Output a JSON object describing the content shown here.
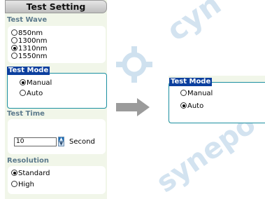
{
  "panel": {
    "title": "Test Setting"
  },
  "test_wave": {
    "heading": "Test Wave",
    "options": [
      "850nm",
      "1300nm",
      "1310nm",
      "1550nm"
    ],
    "selected": "1310nm"
  },
  "test_mode": {
    "heading": "Test Mode",
    "options": [
      "Manual",
      "Auto"
    ],
    "selected": "Manual"
  },
  "test_time": {
    "heading": "Test Time",
    "value": "10",
    "unit": "Second"
  },
  "resolution": {
    "heading": "Resolution",
    "options": [
      "Standard",
      "High"
    ],
    "selected": "Standard"
  },
  "result_panel": {
    "heading": "Test Mode",
    "options": [
      "Manual",
      "Auto"
    ],
    "selected": "Auto"
  },
  "watermark": {
    "top": "cyn",
    "bottom": "synepo"
  },
  "icons": {
    "transition_arrow": "arrow-right-icon",
    "watermark_logo": "gear-logo-icon"
  },
  "colors": {
    "mode_label_bg": "#0b3f9e",
    "mode_border": "#1b8fa0",
    "panel_bg": "#f1f6e9"
  }
}
